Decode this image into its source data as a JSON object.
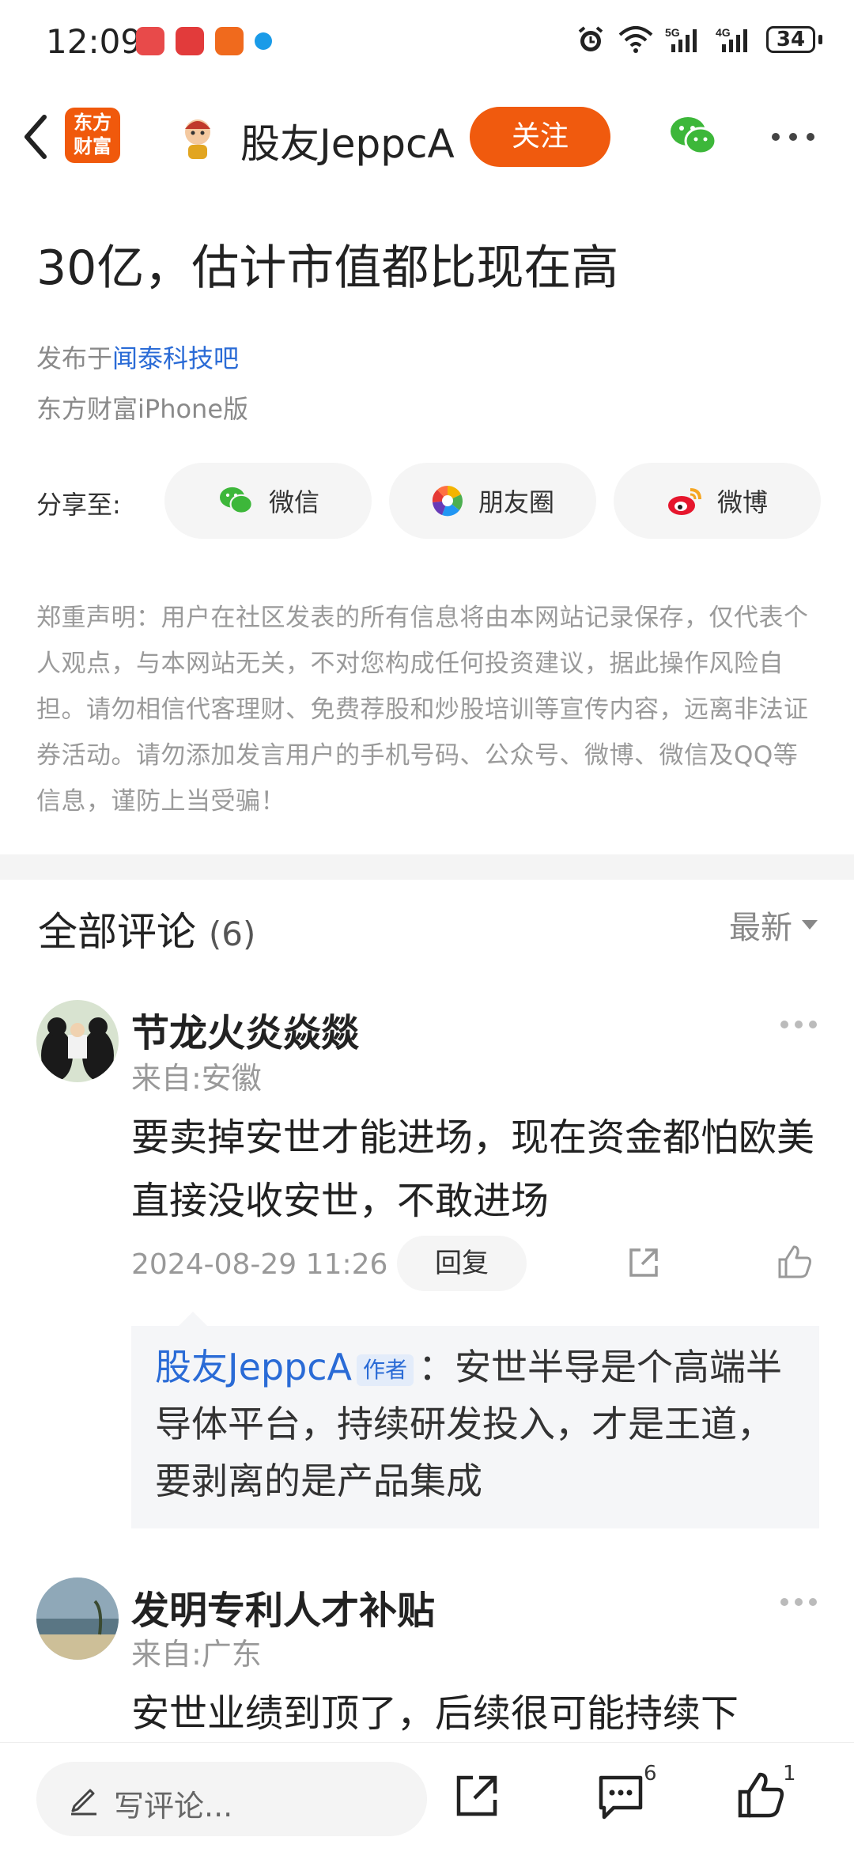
{
  "status_bar": {
    "time": "12:09",
    "network": "5G 4G",
    "battery": "34"
  },
  "header": {
    "brand_logo": "东方\n财富",
    "author": "股友JeppcA",
    "follow_label": "关注",
    "icons": [
      "back-arrow-icon",
      "wechat-icon",
      "more-icon"
    ]
  },
  "article": {
    "title_tail": "30亿，估计市值都比现在高",
    "published_prefix": "发布于",
    "published_forum": "闻泰科技吧",
    "client": "东方财富iPhone版",
    "share_label": "分享至:",
    "share_targets": [
      "微信",
      "朋友圈",
      "微博"
    ],
    "disclaimer": "郑重声明：用户在社区发表的所有信息将由本网站记录保存，仅代表个人观点，与本网站无关，不对您构成任何投资建议，据此操作风险自担。请勿相信代客理财、免费荐股和炒股培训等宣传内容，远离非法证券活动。请勿添加发言用户的手机号码、公众号、微博、微信及QQ等信息，谨防上当受骗！"
  },
  "comments": {
    "title": "全部评论",
    "count": "(6)",
    "sort": "最新",
    "items": [
      {
        "name": "节龙火炎焱燚",
        "location": "来自:安徽",
        "text": "要卖掉安世才能进场，现在资金都怕欧美直接没收安世，不敢进场",
        "date": "2024-08-29 11:26",
        "reply_label": "回复",
        "reply": {
          "author": "股友JeppcA",
          "tag": "作者",
          "text": "：安世半导是个高端半导体平台，持续研发投入，才是王道，要剥离的是产品集成"
        }
      },
      {
        "name": "发明专利人才补贴",
        "location": "来自:广东",
        "text": "安世业绩到顶了，后续很可能持续下"
      }
    ]
  },
  "bottom_bar": {
    "write_placeholder": "写评论...",
    "comment_count": "6",
    "like_count": "1"
  },
  "colors": {
    "accent_orange": "#f05a0e",
    "link_blue": "#2a6bd6",
    "wechat_green": "#3db73a",
    "weibo_red": "#e6162d"
  }
}
